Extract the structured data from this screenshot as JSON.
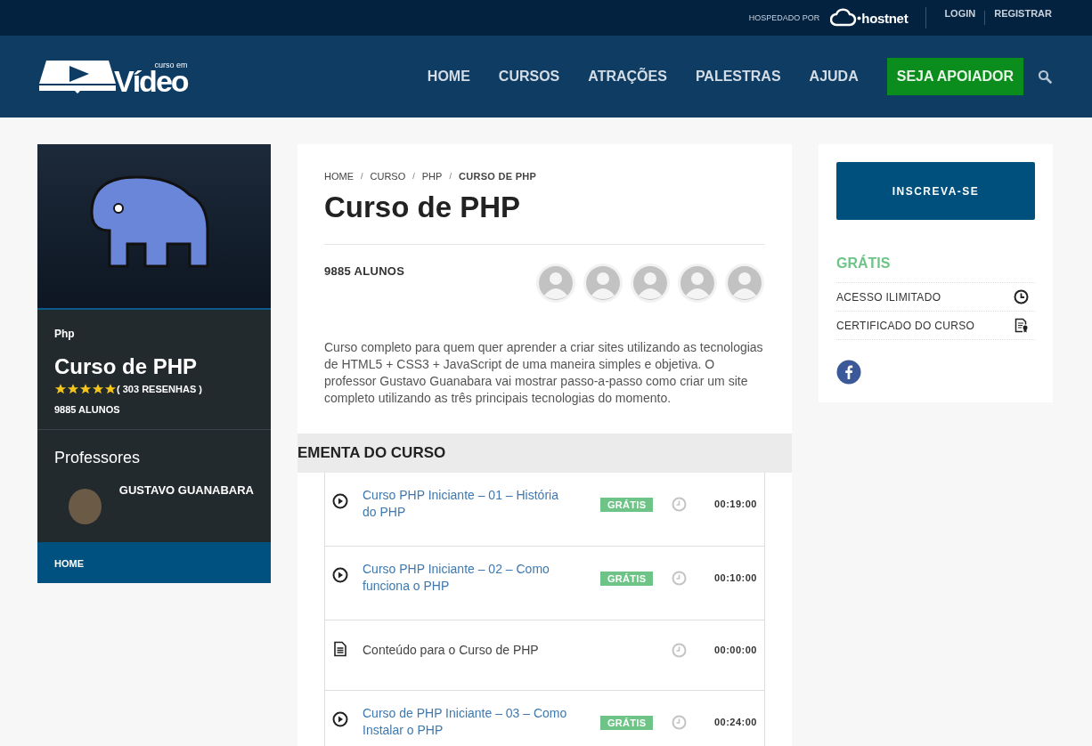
{
  "topbar": {
    "hosted_by": "HOSPEDADO POR",
    "host_name": "hostnet",
    "links": [
      "LOGIN",
      "REGISTRAR"
    ]
  },
  "header": {
    "logo_small": "curso em",
    "logo_big": "Vídeo",
    "nav": [
      {
        "label": "HOME",
        "kind": "link"
      },
      {
        "label": "CURSOS",
        "kind": "link"
      },
      {
        "label": "ATRAÇÕES",
        "kind": "link"
      },
      {
        "label": "PALESTRAS",
        "kind": "link"
      },
      {
        "label": "AJUDA",
        "kind": "link"
      },
      {
        "label": "SEJA APOIADOR",
        "kind": "cta"
      }
    ]
  },
  "sidebar": {
    "category": "Php",
    "title": "Curso de PHP",
    "stars": 5,
    "reviews": "( 303 RESENHAS )",
    "students": "9885 ALUNOS",
    "teachers_heading": "Professores",
    "teacher": "GUSTAVO GUANABARA",
    "menu": [
      "HOME"
    ]
  },
  "course": {
    "breadcrumb": [
      "HOME",
      "CURSO",
      "PHP",
      "CURSO DE PHP"
    ],
    "breadcrumb_separator": "/",
    "title": "Curso de PHP",
    "students": "9885 ALUNOS",
    "student_avatars": [
      {
        "kind": "default"
      },
      {
        "kind": "default"
      },
      {
        "kind": "default"
      },
      {
        "kind": "default"
      },
      {
        "kind": "default"
      }
    ],
    "description": "Curso completo para quem quer aprender a criar sites utilizando as tecnologias de HTML5 + CSS3 + JavaScript de uma maneira simples e objetiva. O professor Gustavo Guanabara vai mostrar passo-a-passo como criar um site completo utilizando as três principais tecnologias do momento.",
    "syllabus_heading": "EMENTA DO CURSO",
    "lessons": [
      {
        "kind": "video",
        "title": "Curso PHP Iniciante – 01 – História do PHP",
        "badge": "GRÁTIS",
        "duration": "00:19:00"
      },
      {
        "kind": "video",
        "title": "Curso PHP Iniciante – 02 – Como funciona o PHP",
        "badge": "GRÁTIS",
        "duration": "00:10:00"
      },
      {
        "kind": "text",
        "title": "Conteúdo para o Curso de PHP",
        "duration": "00:00:00"
      },
      {
        "kind": "video",
        "title": "Curso de PHP Iniciante – 03 – Como Instalar o PHP",
        "badge": "GRÁTIS",
        "duration": "00:24:00"
      }
    ]
  },
  "enroll": {
    "button": "INSCREVA-SE",
    "price": "GRÁTIS",
    "features": [
      {
        "kind": "clock",
        "label": "ACESSO ILIMITADO"
      },
      {
        "kind": "certificate",
        "label": "CERTIFICADO DO CURSO"
      }
    ]
  }
}
